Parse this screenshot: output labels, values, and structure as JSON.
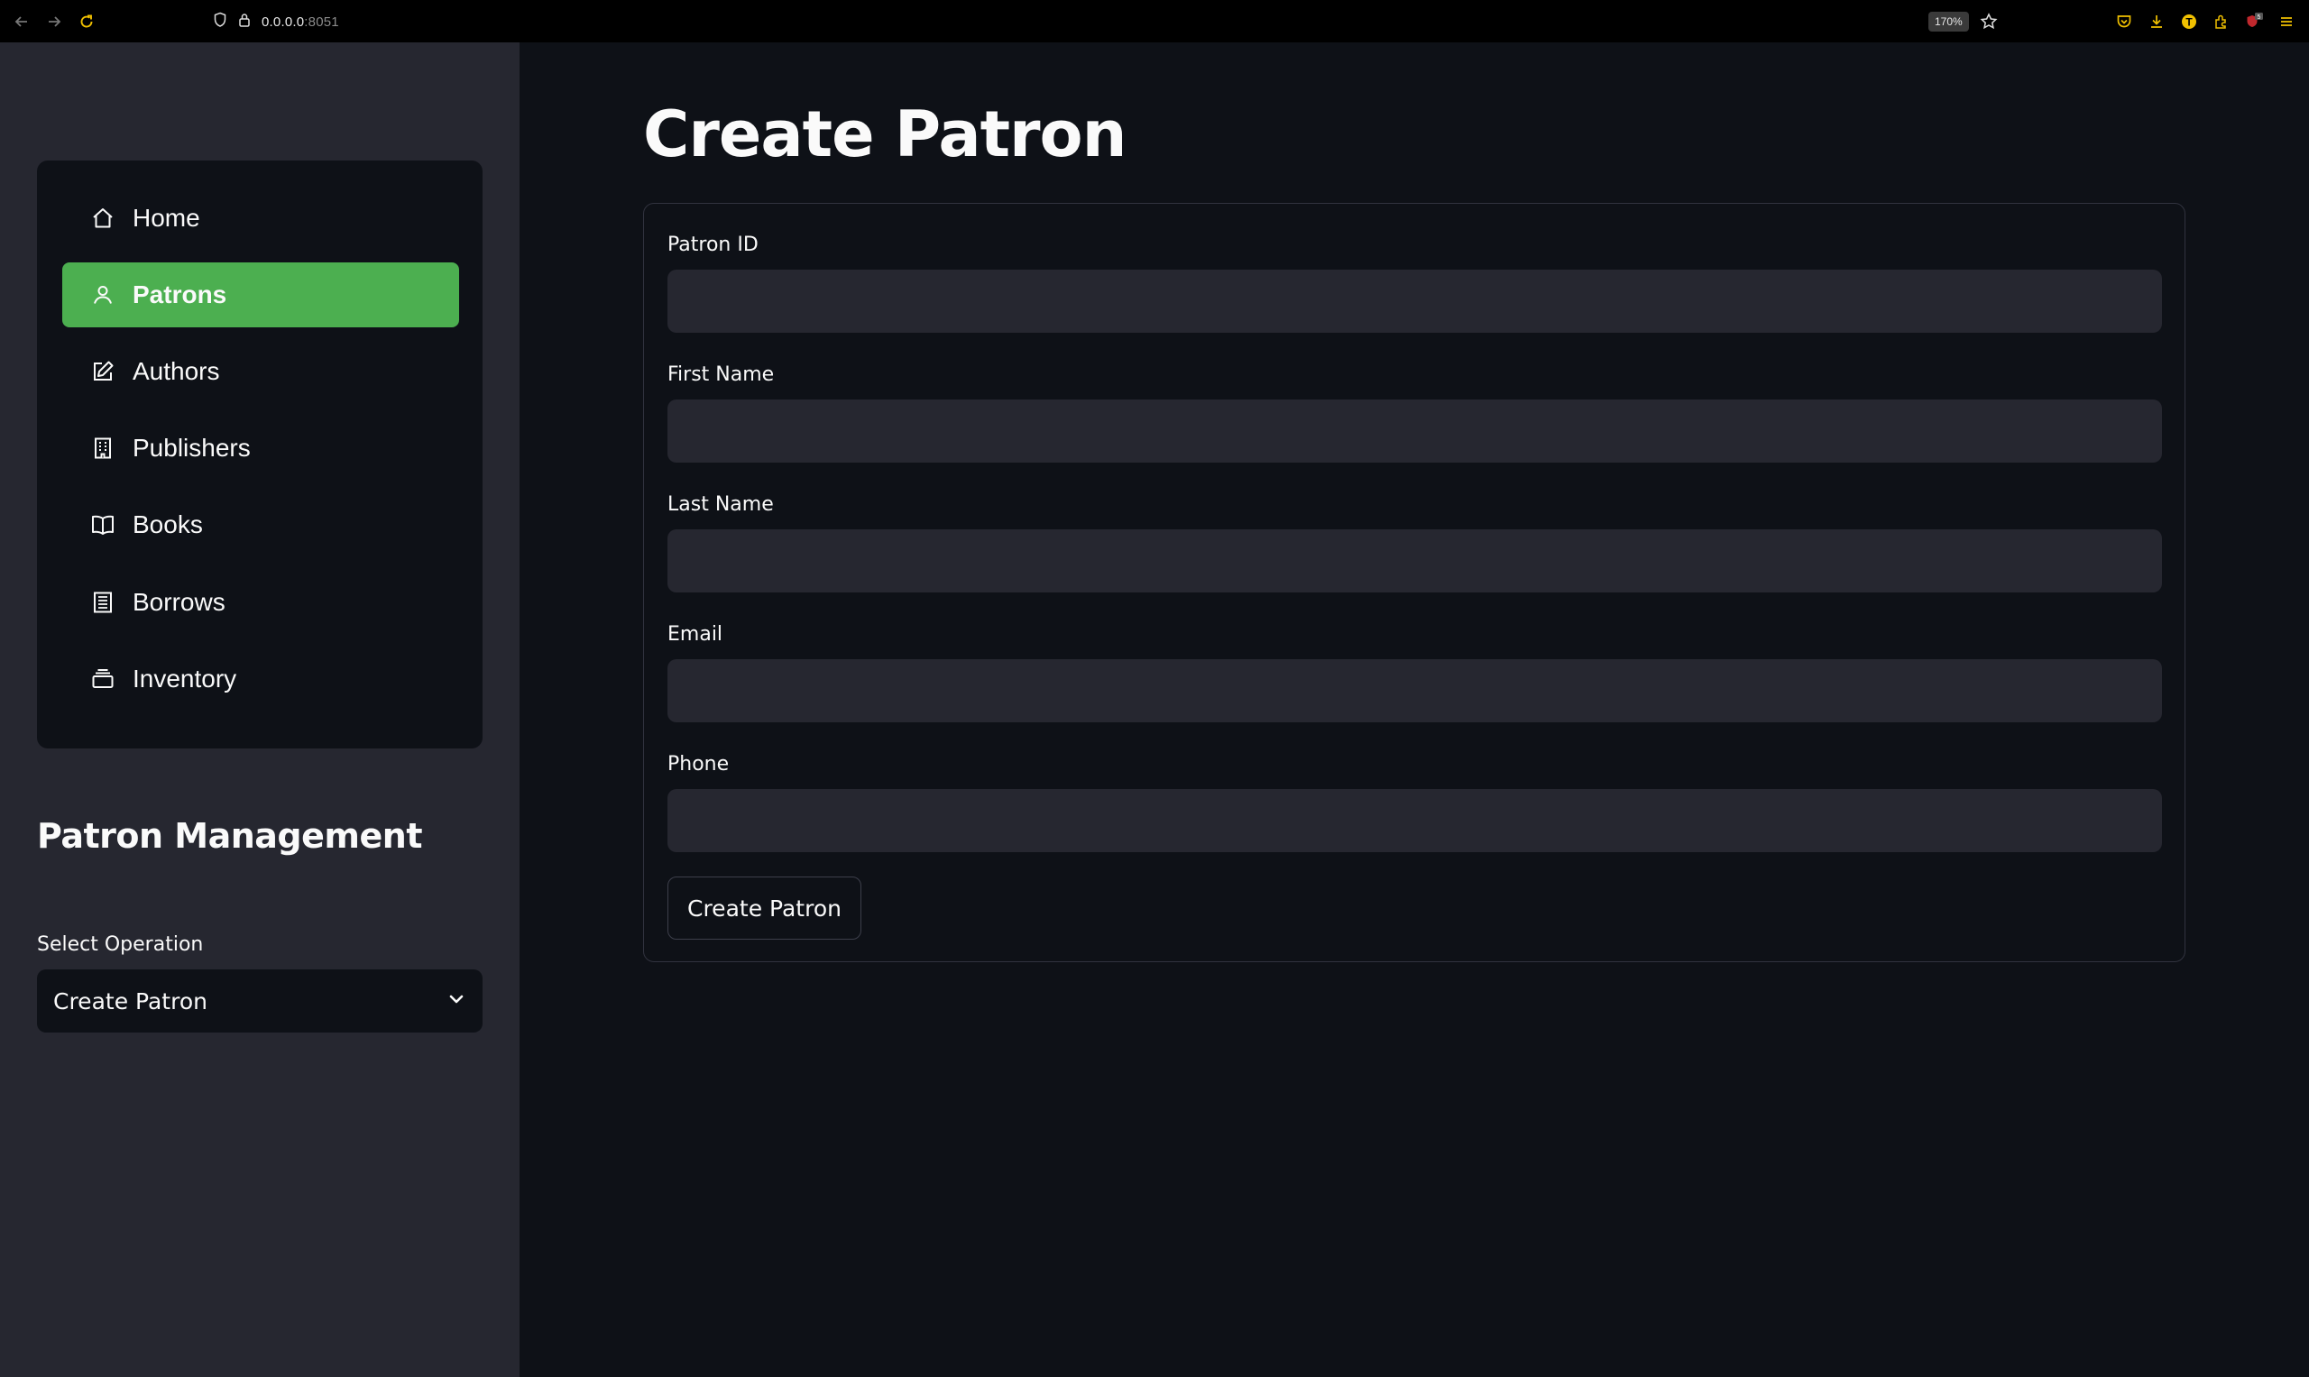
{
  "browser": {
    "url_host": "0.0.0.0",
    "url_port": ":8051",
    "zoom": "170%",
    "notification_count": "5"
  },
  "sidebar": {
    "nav_items": [
      {
        "label": "Home",
        "icon": "home-icon",
        "active": false
      },
      {
        "label": "Patrons",
        "icon": "person-icon",
        "active": true
      },
      {
        "label": "Authors",
        "icon": "edit-icon",
        "active": false
      },
      {
        "label": "Publishers",
        "icon": "building-icon",
        "active": false
      },
      {
        "label": "Books",
        "icon": "book-icon",
        "active": false
      },
      {
        "label": "Borrows",
        "icon": "receipt-icon",
        "active": false
      },
      {
        "label": "Inventory",
        "icon": "stack-icon",
        "active": false
      }
    ],
    "section_heading": "Patron Management",
    "select_label": "Select Operation",
    "select_value": "Create Patron"
  },
  "main": {
    "title": "Create Patron",
    "fields": [
      {
        "label": "Patron ID",
        "value": ""
      },
      {
        "label": "First Name",
        "value": ""
      },
      {
        "label": "Last Name",
        "value": ""
      },
      {
        "label": "Email",
        "value": ""
      },
      {
        "label": "Phone",
        "value": ""
      }
    ],
    "submit_label": "Create Patron"
  },
  "colors": {
    "accent": "#4caf50",
    "background": "#0e1117",
    "sidebar": "#262730"
  }
}
